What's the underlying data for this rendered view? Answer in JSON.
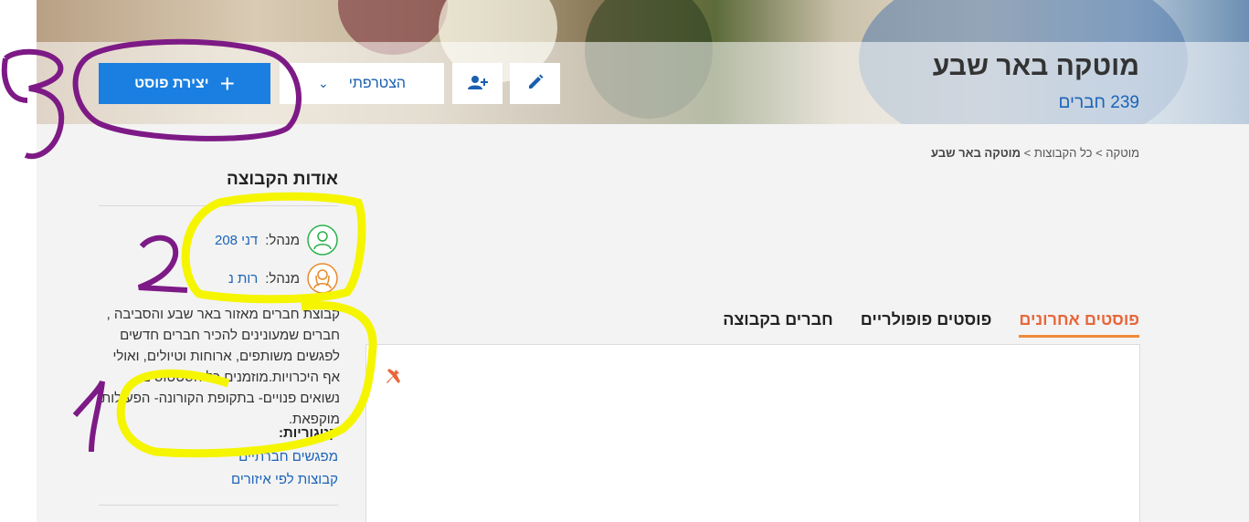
{
  "header": {
    "group_title": "מוטקה באר שבע",
    "members": "239 חברים",
    "create_post_label": "יצירת פוסט",
    "join_label": "הצטרפתי"
  },
  "breadcrumb": {
    "items": [
      "מוטקה",
      "כל הקבוצות"
    ],
    "current": "מוטקה באר שבע",
    "separator": ">"
  },
  "sidebar": {
    "about_title": "אודות הקבוצה",
    "admins": [
      {
        "label": "מנהל:",
        "name": "דני 208"
      },
      {
        "label": "מנהל:",
        "name": "רות נ"
      }
    ],
    "description": "קבוצת חברים מאזור באר שבע והסביבה , חברים שמעונינים להכיר חברים חדשים לפגשים משותפים, ארוחות וטיולים, ואולי אף היכרויות.מוזמנים כל הסטטוסים נשואים פנויים- בתקופת הקורונה- הפעילות מוקפאת.",
    "categories_title": "קטגוריות:",
    "categories": [
      "מפגשים חברתיים",
      "קבוצות לפי איזורים"
    ]
  },
  "tabs": [
    {
      "label": "פוסטים אחרונים",
      "active": true
    },
    {
      "label": "פוסטים פופולריים",
      "active": false
    },
    {
      "label": "חברים בקבוצה",
      "active": false
    }
  ],
  "annotations": {
    "numbers": [
      "1",
      "2",
      "3"
    ],
    "yellow_color": "#f5f500",
    "purple_color": "#7d1a86"
  },
  "colors": {
    "accent_blue": "#1a7fe0",
    "link_blue": "#1b63b8",
    "tab_active": "#e8663a"
  },
  "icons": [
    "plus-icon",
    "chevron-down-icon",
    "add-user-icon",
    "pencil-icon",
    "admin-male-icon",
    "admin-female-icon",
    "pin-icon"
  ]
}
